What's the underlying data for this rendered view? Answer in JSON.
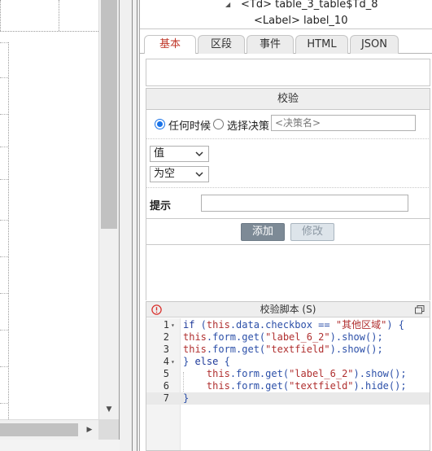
{
  "tree": {
    "rows": [
      {
        "text": "<Td> table_3_table$Td_8"
      },
      {
        "text": "<Label> label_10"
      }
    ]
  },
  "tabs": [
    {
      "label": "基本",
      "active": true
    },
    {
      "label": "区段",
      "active": false
    },
    {
      "label": "事件",
      "active": false
    },
    {
      "label": "HTML",
      "active": false
    },
    {
      "label": "JSON",
      "active": false
    }
  ],
  "validation": {
    "section_title": "校验",
    "radio_anytime": "任何时候",
    "radio_policy": "选择决策",
    "policy_placeholder": "<决策名>",
    "value_select": "值",
    "condition_select": "为空",
    "hint_label": "提示",
    "hint_value": "",
    "add_button": "添加",
    "edit_button": "修改"
  },
  "script": {
    "title": "校验脚本 (S)",
    "lines": [
      {
        "n": "1",
        "fold": true,
        "text": "if (this.data.checkbox == \"其他区域\") {"
      },
      {
        "n": "2",
        "fold": false,
        "text": "this.form.get(\"label_6_2\").show();"
      },
      {
        "n": "3",
        "fold": false,
        "text": "this.form.get(\"textfield\").show();"
      },
      {
        "n": "4",
        "fold": true,
        "text": "} else {"
      },
      {
        "n": "5",
        "fold": false,
        "text": "    this.form.get(\"label_6_2\").show();"
      },
      {
        "n": "6",
        "fold": false,
        "text": "    this.form.get(\"textfield\").hide();"
      },
      {
        "n": "7",
        "fold": false,
        "text": "}"
      }
    ]
  },
  "colors": {
    "active_tab_text": "#c0392b",
    "add_button_bg": "#7d8a96",
    "error_icon": "#d9302c",
    "radio_selected": "#1a73e8"
  }
}
